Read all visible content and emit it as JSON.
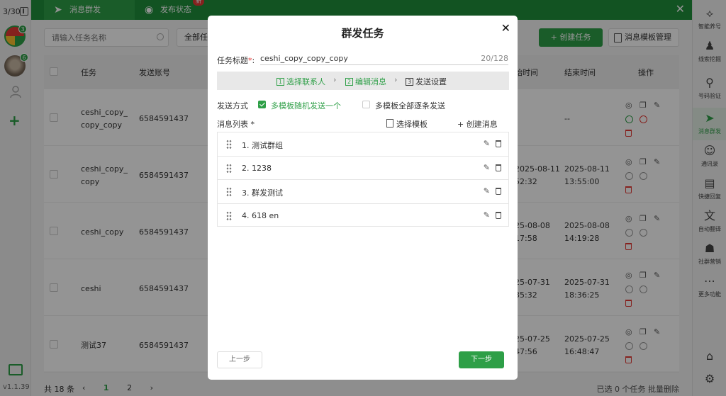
{
  "left_rail": {
    "counter": "3/30",
    "avatar1_badge": "3",
    "avatar2_badge": "6",
    "version": "v1.1.39"
  },
  "tabs": [
    {
      "label": "消息群发",
      "active": true
    },
    {
      "label": "发布状态",
      "badge": "新"
    }
  ],
  "toolbar": {
    "search_placeholder": "请输入任务名称",
    "filter_label": "全部任",
    "create_task": "+ 创建任务",
    "template_manage": "消息模板管理"
  },
  "table": {
    "headers": {
      "task": "任务",
      "account": "发送账号",
      "start": "始时间",
      "end": "结束时间",
      "ops": "操作"
    },
    "rows": [
      {
        "task_line1": "ceshi_copy_",
        "task_line2": "copy_copy",
        "account": "6584591437",
        "start_line1": "",
        "start_line2": "",
        "end_line1": "--",
        "end_line2": ""
      },
      {
        "task_line1": "ceshi_copy_",
        "task_line2": "copy",
        "account": "6584591437",
        "start_line1": "2025-08-11",
        "start_line2": "52:32",
        "end_line1": "2025-08-11",
        "end_line2": "13:55:00"
      },
      {
        "task_line1": "ceshi_copy",
        "task_line2": "",
        "account": "6584591437",
        "start_line1": "25-08-08",
        "start_line2": "17:58",
        "end_line1": "2025-08-08",
        "end_line2": "14:19:28"
      },
      {
        "task_line1": "ceshi",
        "task_line2": "",
        "account": "6584591437",
        "start_line1": "25-07-31",
        "start_line2": "35:32",
        "end_line1": "2025-07-31",
        "end_line2": "18:36:25"
      },
      {
        "task_line1": "测试37",
        "task_line2": "",
        "account": "6584591437",
        "start_line1": "25-07-25",
        "start_line2": "47:56",
        "end_line1": "2025-07-25",
        "end_line2": "16:48:47"
      }
    ]
  },
  "footer": {
    "total": "共 18 条",
    "prev": "‹",
    "page1": "1",
    "page2": "2",
    "next": "›",
    "selected": "已选 0 个任务 批量删除"
  },
  "right_rail": [
    {
      "label": "智能养号",
      "icon": "share-icon"
    },
    {
      "label": "线索挖掘",
      "icon": "person-pin-icon"
    },
    {
      "label": "号码验证",
      "icon": "person-search-icon"
    },
    {
      "label": "消息群发",
      "icon": "send-icon",
      "active": true
    },
    {
      "label": "通讯录",
      "icon": "contacts-icon"
    },
    {
      "label": "快捷回复",
      "icon": "chat-icon"
    },
    {
      "label": "自动翻译",
      "icon": "translate-icon"
    },
    {
      "label": "社群营销",
      "icon": "group-icon"
    },
    {
      "label": "更多功能",
      "icon": "more-icon"
    }
  ],
  "modal": {
    "title": "群发任务",
    "title_label": "任务标题",
    "required_mark": "*",
    "title_value": "ceshi_copy_copy_copy",
    "title_count": "20/128",
    "steps": [
      {
        "num": "1",
        "label": "选择联系人"
      },
      {
        "num": "2",
        "label": "编辑消息"
      },
      {
        "num": "3",
        "label": "发送设置"
      }
    ],
    "step_sep": "›",
    "send_mode_label": "发送方式",
    "mode_random": "多模板随机发送一个",
    "mode_all": "多模板全部逐条发送",
    "msg_list_label": "消息列表 *",
    "choose_template": "选择模板",
    "create_message": "+ 创建消息",
    "messages": [
      "1. 测试群组",
      "2. 1238",
      "3. 群发测试",
      "4. 618 en"
    ],
    "prev": "上一步",
    "next": "下一步"
  },
  "colors": {
    "accent": "#2e9f47",
    "danger": "#e53935"
  }
}
